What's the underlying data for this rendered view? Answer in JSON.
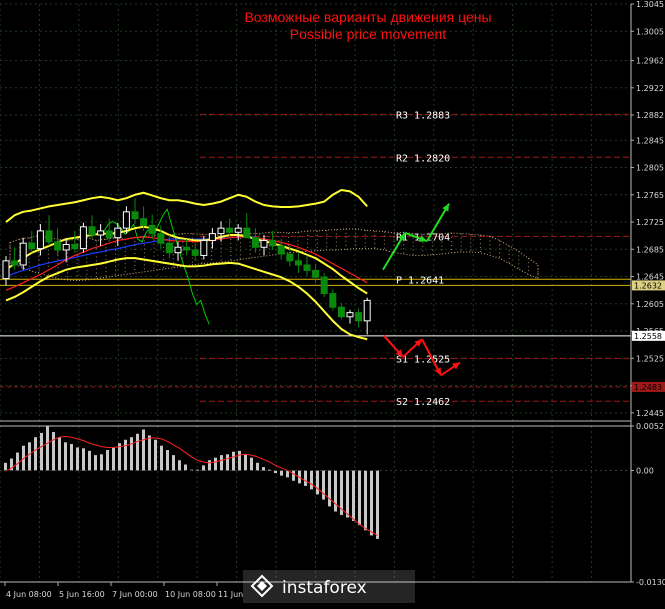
{
  "chart_data": {
    "type": "candlestick",
    "title_ru": "Возможные варианты движения цены",
    "title_en": "Possible price movement",
    "colors": {
      "background": "#000000",
      "grid": "#1f3b1f",
      "level_line": "#a01818",
      "pivot_line": "#d4b400",
      "candle_up": "#ffffff",
      "candle_down": "#0a8a0a",
      "bollinger": "#ffff33",
      "ma_red": "#ff2020",
      "ma_blue": "#1c3cff",
      "green_line": "#00cc00",
      "cloud": "#d0b080",
      "arrow_up": "#22dd22",
      "arrow_down": "#ff1010",
      "histogram": "#c8c8c8",
      "signal": "#ff2020",
      "axis_text": "#d8d8d8"
    },
    "price_axis": {
      "ylim": [
        1.2433,
        1.3045
      ],
      "ticks": [
        "1.3045",
        "1.3005",
        "1.2962",
        "1.2922",
        "1.2882",
        "1.2845",
        "1.2805",
        "1.2765",
        "1.2725",
        "1.2685",
        "1.2645",
        "1.2605",
        "1.2565",
        "1.2525",
        "1.2485",
        "1.2445"
      ],
      "current_price_labels": [
        "1.2632",
        "1.2558",
        "1.2483"
      ]
    },
    "levels": [
      {
        "name": "R3",
        "value": 1.2883,
        "label": "R3  1.2883"
      },
      {
        "name": "R2",
        "value": 1.282,
        "label": "R2  1.2820"
      },
      {
        "name": "R1",
        "value": 1.2704,
        "label": "R1  1.2704"
      },
      {
        "name": "P",
        "value": 1.2641,
        "label": "P  1.2641"
      },
      {
        "name": "S1",
        "value": 1.2525,
        "label": "S1  1.2525"
      },
      {
        "name": "S2",
        "value": 1.2462,
        "label": "S2  1.2462"
      }
    ],
    "candles": [
      [
        1.2642,
        1.2675,
        1.2632,
        1.2668
      ],
      [
        1.2668,
        1.2688,
        1.2655,
        1.2662
      ],
      [
        1.2662,
        1.2702,
        1.2655,
        1.2694
      ],
      [
        1.2694,
        1.2712,
        1.268,
        1.2686
      ],
      [
        1.2686,
        1.2722,
        1.2676,
        1.2712
      ],
      [
        1.2712,
        1.2735,
        1.269,
        1.2696
      ],
      [
        1.2696,
        1.2716,
        1.2676,
        1.2684
      ],
      [
        1.2684,
        1.27,
        1.2666,
        1.2692
      ],
      [
        1.2692,
        1.2712,
        1.268,
        1.2686
      ],
      [
        1.2686,
        1.2724,
        1.268,
        1.2718
      ],
      [
        1.2718,
        1.2735,
        1.27,
        1.2706
      ],
      [
        1.2706,
        1.2722,
        1.269,
        1.2712
      ],
      [
        1.2712,
        1.273,
        1.2696,
        1.2702
      ],
      [
        1.2702,
        1.2724,
        1.269,
        1.2716
      ],
      [
        1.2716,
        1.2748,
        1.2708,
        1.274
      ],
      [
        1.274,
        1.276,
        1.2722,
        1.273
      ],
      [
        1.273,
        1.2748,
        1.2712,
        1.272
      ],
      [
        1.272,
        1.2736,
        1.27,
        1.2708
      ],
      [
        1.2708,
        1.272,
        1.2686,
        1.2694
      ],
      [
        1.2694,
        1.2706,
        1.2672,
        1.268
      ],
      [
        1.268,
        1.2696,
        1.2668,
        1.2688
      ],
      [
        1.2688,
        1.27,
        1.2676,
        1.2684
      ],
      [
        1.2684,
        1.2694,
        1.2668,
        1.2676
      ],
      [
        1.2676,
        1.2704,
        1.267,
        1.2698
      ],
      [
        1.2698,
        1.2716,
        1.2686,
        1.2708
      ],
      [
        1.2708,
        1.2726,
        1.2696,
        1.2716
      ],
      [
        1.2716,
        1.273,
        1.2704,
        1.271
      ],
      [
        1.271,
        1.2722,
        1.2698,
        1.2716
      ],
      [
        1.2716,
        1.2738,
        1.2708,
        1.2702
      ],
      [
        1.2702,
        1.2716,
        1.268,
        1.2688
      ],
      [
        1.2688,
        1.2706,
        1.2676,
        1.2698
      ],
      [
        1.2698,
        1.2712,
        1.2684,
        1.269
      ],
      [
        1.269,
        1.27,
        1.267,
        1.2678
      ],
      [
        1.2678,
        1.269,
        1.266,
        1.2668
      ],
      [
        1.2668,
        1.268,
        1.265,
        1.2662
      ],
      [
        1.2662,
        1.2676,
        1.2646,
        1.2654
      ],
      [
        1.2654,
        1.2664,
        1.2636,
        1.2644
      ],
      [
        1.2644,
        1.265,
        1.2615,
        1.262
      ],
      [
        1.262,
        1.2626,
        1.2595,
        1.26
      ],
      [
        1.26,
        1.2606,
        1.2582,
        1.2586
      ],
      [
        1.2586,
        1.2596,
        1.2576,
        1.2592
      ],
      [
        1.2592,
        1.2598,
        1.257,
        1.258
      ],
      [
        1.258,
        1.2614,
        1.256,
        1.261
      ]
    ],
    "bollinger_upper": [
      1.2725,
      1.2735,
      1.274,
      1.2742,
      1.2745,
      1.2748,
      1.275,
      1.2752,
      1.2754,
      1.2757,
      1.276,
      1.2762,
      1.276,
      1.2757,
      1.276,
      1.2765,
      1.2768,
      1.2764,
      1.276,
      1.2757,
      1.2757,
      1.2755,
      1.2752,
      1.275,
      1.2752,
      1.2755,
      1.276,
      1.2765,
      1.2762,
      1.2755,
      1.275,
      1.2748,
      1.2747,
      1.2747,
      1.2748,
      1.275,
      1.2752,
      1.2755,
      1.2765,
      1.2772,
      1.277,
      1.2762,
      1.2748
    ],
    "bollinger_mid": [
      1.2655,
      1.2664,
      1.2672,
      1.268,
      1.2685,
      1.269,
      1.2695,
      1.27,
      1.2702,
      1.2704,
      1.2706,
      1.2708,
      1.2708,
      1.2709,
      1.2712,
      1.2716,
      1.2718,
      1.2716,
      1.2712,
      1.2706,
      1.2702,
      1.27,
      1.2698,
      1.2698,
      1.27,
      1.2703,
      1.2706,
      1.2706,
      1.2704,
      1.27,
      1.2697,
      1.2694,
      1.269,
      1.2686,
      1.2682,
      1.2677,
      1.2672,
      1.2664,
      1.2656,
      1.2646,
      1.2637,
      1.2628,
      1.262
    ],
    "bollinger_lower": [
      1.261,
      1.2615,
      1.2622,
      1.263,
      1.2638,
      1.2645,
      1.265,
      1.2655,
      1.2658,
      1.266,
      1.2662,
      1.2664,
      1.2667,
      1.267,
      1.2672,
      1.2672,
      1.267,
      1.2668,
      1.2666,
      1.2664,
      1.2662,
      1.266,
      1.266,
      1.2661,
      1.2663,
      1.2664,
      1.2665,
      1.2664,
      1.266,
      1.2656,
      1.2652,
      1.2648,
      1.2644,
      1.2638,
      1.263,
      1.262,
      1.2608,
      1.2594,
      1.258,
      1.2568,
      1.256,
      1.2556,
      1.2553
    ],
    "ma_red": [
      1.2625,
      1.263,
      1.2636,
      1.2642,
      1.2648,
      1.2655,
      1.2662,
      1.267,
      1.2676,
      1.2681,
      1.2686,
      1.269,
      1.2694,
      1.2698,
      1.27,
      1.2702,
      1.2703,
      1.2702,
      1.27,
      1.2698,
      1.2697,
      1.2697,
      1.2696,
      1.2697,
      1.2698,
      1.27,
      1.2702,
      1.2703,
      1.2703,
      1.2702,
      1.27,
      1.2698,
      1.2695,
      1.2692,
      1.2688,
      1.2683,
      1.2678,
      1.2671,
      1.2664,
      1.2657,
      1.265,
      1.2643,
      1.2636
    ],
    "ma_blue": [
      1.2645,
      1.265,
      1.2654,
      1.2658,
      1.2662,
      1.2665,
      1.2668,
      1.267,
      1.2673,
      1.2676,
      1.2679,
      1.2681,
      1.2684,
      1.2686,
      1.2689,
      1.2692,
      1.2694,
      1.2696,
      1.2698,
      1.27,
      1.27,
      1.27,
      1.27,
      1.27,
      1.27,
      1.2701,
      1.2702,
      1.2703,
      1.2703,
      1.2703
    ],
    "green_line": [
      1.2705,
      1.2712,
      1.2722,
      1.2726,
      1.2722,
      1.2716,
      1.2707,
      1.2712,
      1.2722,
      1.27,
      1.2696,
      1.271,
      1.2716,
      1.2707,
      1.2722,
      1.2735,
      1.2744,
      1.2722,
      1.2701,
      1.268,
      1.266,
      1.2643,
      1.262,
      1.2604,
      1.261,
      1.259,
      1.2575
    ],
    "cloud_upper": [
      1.2695,
      1.27,
      1.2702,
      1.2705,
      1.2702,
      1.27,
      1.2698,
      1.27,
      1.2702,
      1.2698,
      1.27,
      1.2702,
      1.27,
      1.2703,
      1.2704,
      1.2705,
      1.2706,
      1.2707,
      1.2708,
      1.2708,
      1.2707,
      1.2706,
      1.2705,
      1.2706,
      1.2707,
      1.2708,
      1.2708,
      1.271,
      1.271,
      1.2709,
      1.271,
      1.2712,
      1.2712,
      1.2713,
      1.2714,
      1.2715,
      1.2715,
      1.2713,
      1.2712,
      1.2711,
      1.2709,
      1.271,
      1.2708,
      1.2707,
      1.2708,
      1.2708,
      1.2709,
      1.2708,
      1.2707,
      1.2706,
      1.2704,
      1.2698,
      1.269,
      1.2682,
      1.2672,
      1.2662
    ],
    "cloud_lower": [
      1.2665,
      1.266,
      1.2654,
      1.265,
      1.2646,
      1.2642,
      1.264,
      1.2639,
      1.264,
      1.2642,
      1.2644,
      1.2646,
      1.2648,
      1.265,
      1.2652,
      1.2654,
      1.2656,
      1.2658,
      1.266,
      1.2662,
      1.2664,
      1.2665,
      1.2666,
      1.2668,
      1.267,
      1.2672,
      1.2674,
      1.2676,
      1.2678,
      1.268,
      1.2681,
      1.2682,
      1.2683,
      1.2684,
      1.2684,
      1.2685,
      1.2686,
      1.2686,
      1.2686,
      1.2684,
      1.268,
      1.2678,
      1.2676,
      1.2676,
      1.2677,
      1.2678,
      1.268,
      1.2681,
      1.2681,
      1.268,
      1.2676,
      1.2672,
      1.2664,
      1.2656,
      1.2648,
      1.2642
    ],
    "macd_axis": {
      "ylim": [
        -0.01305,
        0.00521
      ],
      "ticks": [
        "0.00521",
        "0.00",
        "-0.01305"
      ]
    },
    "macd_hist": [
      0.0009,
      0.0014,
      0.0021,
      0.0029,
      0.0033,
      0.0039,
      0.0044,
      0.0052,
      0.0045,
      0.0039,
      0.0033,
      0.0031,
      0.0027,
      0.0026,
      0.0023,
      0.0018,
      0.0019,
      0.0024,
      0.0027,
      0.0032,
      0.0036,
      0.0039,
      0.0043,
      0.0048,
      0.0041,
      0.0036,
      0.0029,
      0.0024,
      0.0018,
      0.0012,
      0.0007,
      0.0001,
      0.0001,
      0.0006,
      0.0012,
      0.0015,
      0.0018,
      0.0019,
      0.0022,
      0.0023,
      0.0019,
      0.0015,
      0.0009,
      0.0004,
      0.0001,
      -0.0003,
      -0.0006,
      -0.0008,
      -0.0012,
      -0.0015,
      -0.0018,
      -0.0022,
      -0.0028,
      -0.0034,
      -0.0042,
      -0.0048,
      -0.0052,
      -0.0055,
      -0.0059,
      -0.0064,
      -0.007,
      -0.0076,
      -0.008
    ],
    "macd_signal": [
      -0.0001,
      0.0003,
      0.0008,
      0.0014,
      0.0019,
      0.0024,
      0.0028,
      0.0032,
      0.0036,
      0.0039,
      0.004,
      0.0039,
      0.0037,
      0.0035,
      0.0032,
      0.003,
      0.0028,
      0.0027,
      0.0027,
      0.0028,
      0.0029,
      0.0031,
      0.0034,
      0.0036,
      0.0038,
      0.0038,
      0.0037,
      0.0034,
      0.003,
      0.0026,
      0.0021,
      0.0016,
      0.0012,
      0.001,
      0.0009,
      0.001,
      0.0012,
      0.0014,
      0.0016,
      0.0018,
      0.0019,
      0.0018,
      0.0016,
      0.0013,
      0.001,
      0.0006,
      0.0003,
      0.0,
      -0.0004,
      -0.0008,
      -0.0012,
      -0.0016,
      -0.0021,
      -0.0027,
      -0.0033,
      -0.0039,
      -0.0045,
      -0.0051,
      -0.0057,
      -0.0063,
      -0.0068,
      -0.0072,
      -0.0076
    ],
    "time_axis": {
      "labels": [
        "4 Jun 08:00",
        "5 Jun 16:00",
        "7 Jun 00:00",
        "10 Jun 08:00",
        "11 Jun"
      ]
    },
    "forecast_arrows": {
      "bull": [
        [
          1.2655,
          1.2709
        ],
        [
          1.2709,
          1.2697
        ],
        [
          1.2697,
          1.2752
        ]
      ],
      "bear": [
        [
          1.2558,
          1.2527
        ],
        [
          1.2527,
          1.2553
        ],
        [
          1.2553,
          1.25
        ],
        [
          1.25,
          1.2519
        ]
      ]
    }
  },
  "watermark": {
    "brand": "instaforex"
  }
}
